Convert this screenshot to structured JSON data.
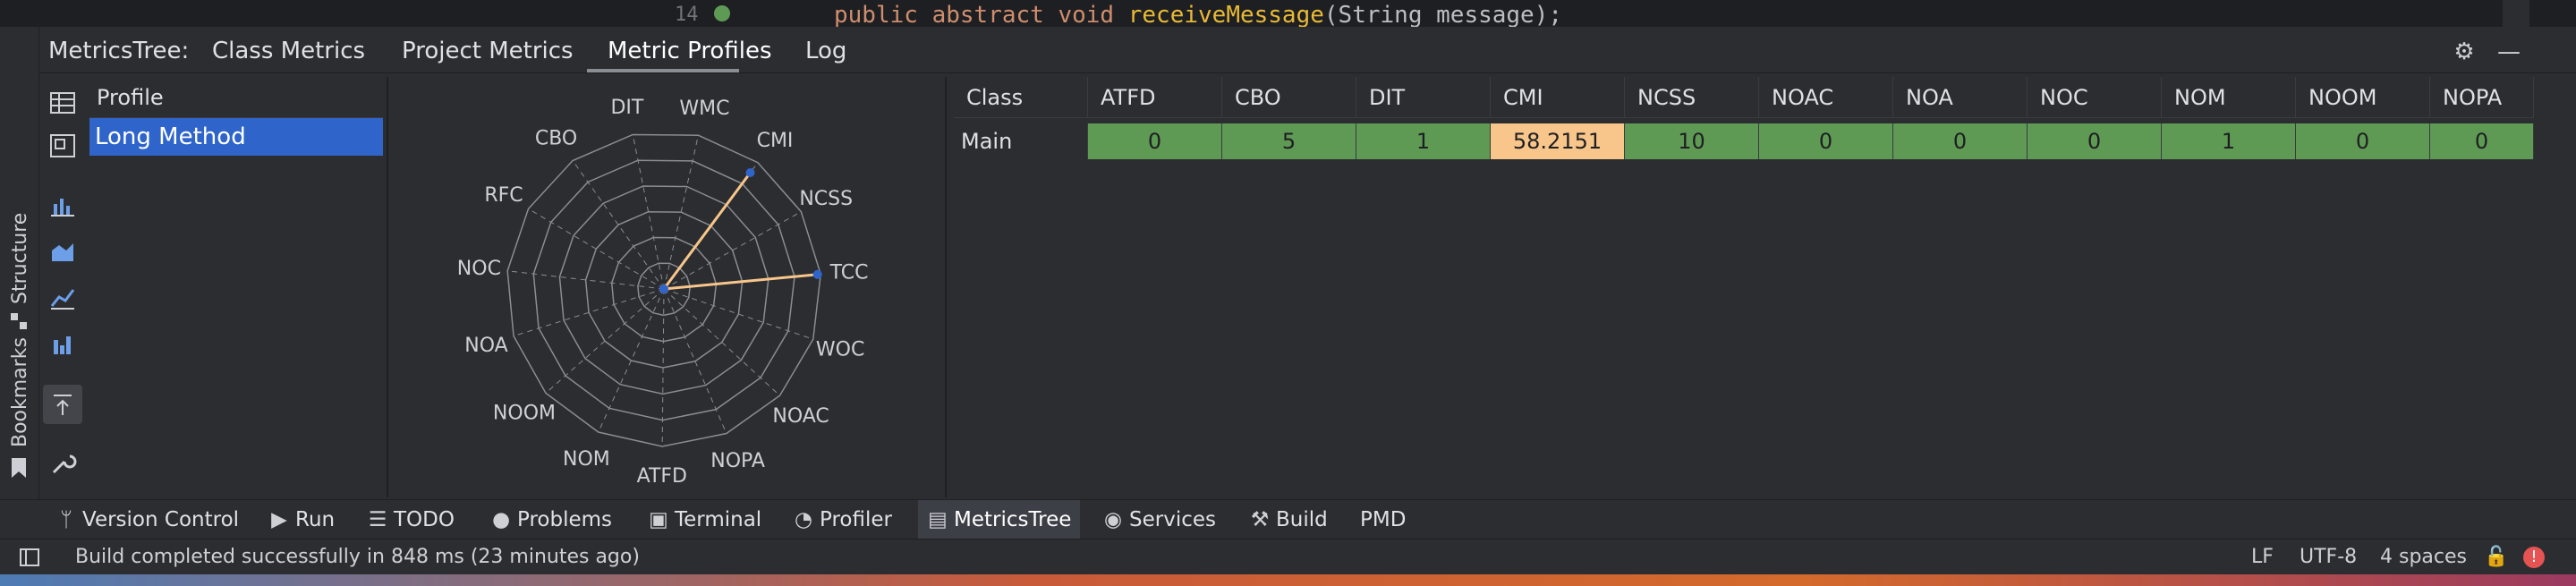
{
  "editor": {
    "line_number": "14",
    "code_keyword1": "public",
    "code_keyword2": "abstract",
    "code_keyword3": "void",
    "code_function": "receiveMessage",
    "code_rest": "(String message);"
  },
  "side_stripe": {
    "structure_label": "Structure",
    "bookmarks_label": "Bookmarks"
  },
  "tool_window": {
    "title": "MetricsTree:",
    "tabs": [
      "Class Metrics",
      "Project Metrics",
      "Metric Profiles",
      "Log"
    ],
    "active_tab": "Metric Profiles"
  },
  "profile": {
    "header": "Profile",
    "items": [
      "Long Method"
    ]
  },
  "radar": {
    "axes": [
      "WMC",
      "CMI",
      "NCSS",
      "TCC",
      "WOC",
      "NOAC",
      "NOPA",
      "ATFD",
      "NOM",
      "NOOM",
      "NOA",
      "NOC",
      "RFC",
      "CBO",
      "DIT"
    ],
    "values": [
      0,
      0.92,
      0,
      0.98,
      0,
      0,
      0,
      0,
      0,
      0,
      0,
      0,
      0,
      0,
      0
    ],
    "rings": 6,
    "line_color": "#f8c68b",
    "point_color": "#2f65ca"
  },
  "table": {
    "columns": [
      "Class",
      "ATFD",
      "CBO",
      "DIT",
      "CMI",
      "NCSS",
      "NOAC",
      "NOA",
      "NOC",
      "NOM",
      "NOOM",
      "NOPA"
    ],
    "rows": [
      {
        "name": "Main",
        "values": [
          "0",
          "5",
          "1",
          "58.2151",
          "10",
          "0",
          "0",
          "0",
          "1",
          "0",
          "0"
        ],
        "highlight": [
          "green",
          "green",
          "green",
          "orange",
          "green",
          "green",
          "green",
          "green",
          "green",
          "green",
          "green"
        ]
      }
    ]
  },
  "bottom_bar": {
    "items": [
      "Version Control",
      "Run",
      "TODO",
      "Problems",
      "Terminal",
      "Profiler",
      "MetricsTree",
      "Services",
      "Build",
      "PMD"
    ],
    "active": "MetricsTree"
  },
  "status": {
    "message": "Build completed successfully in 848 ms (23 minutes ago)",
    "line_separator": "LF",
    "encoding": "UTF-8",
    "indent": "4 spaces"
  },
  "colors": {
    "accent": "#2f65ca",
    "good": "#5f9a55",
    "warn": "#f8c68b"
  }
}
